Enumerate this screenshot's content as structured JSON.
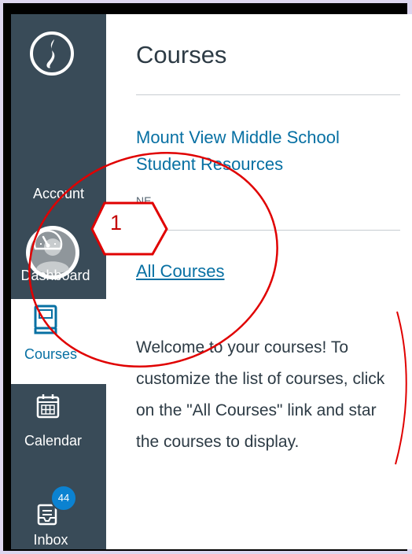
{
  "nav": {
    "items": [
      {
        "id": "account",
        "label": "Account"
      },
      {
        "id": "dashboard",
        "label": "Dashboard"
      },
      {
        "id": "courses",
        "label": "Courses"
      },
      {
        "id": "calendar",
        "label": "Calendar"
      },
      {
        "id": "inbox",
        "label": "Inbox",
        "badge": "44"
      }
    ]
  },
  "tray": {
    "title": "Courses",
    "close_label": "×",
    "course": {
      "name": "Mount View Middle School Student Resources",
      "term": "NE"
    },
    "all_courses_link": "All Courses",
    "welcome_text": "Welcome to your courses! To customize the list of courses, click on the \"All Courses\" link and star the courses to display."
  },
  "annotation": {
    "step_number": "1",
    "color": "#e00000"
  },
  "colors": {
    "nav_bg": "#394b58",
    "link": "#0770a3",
    "badge": "#0b82d1",
    "frame": "#000000",
    "page_bg": "#ddd6ef"
  }
}
